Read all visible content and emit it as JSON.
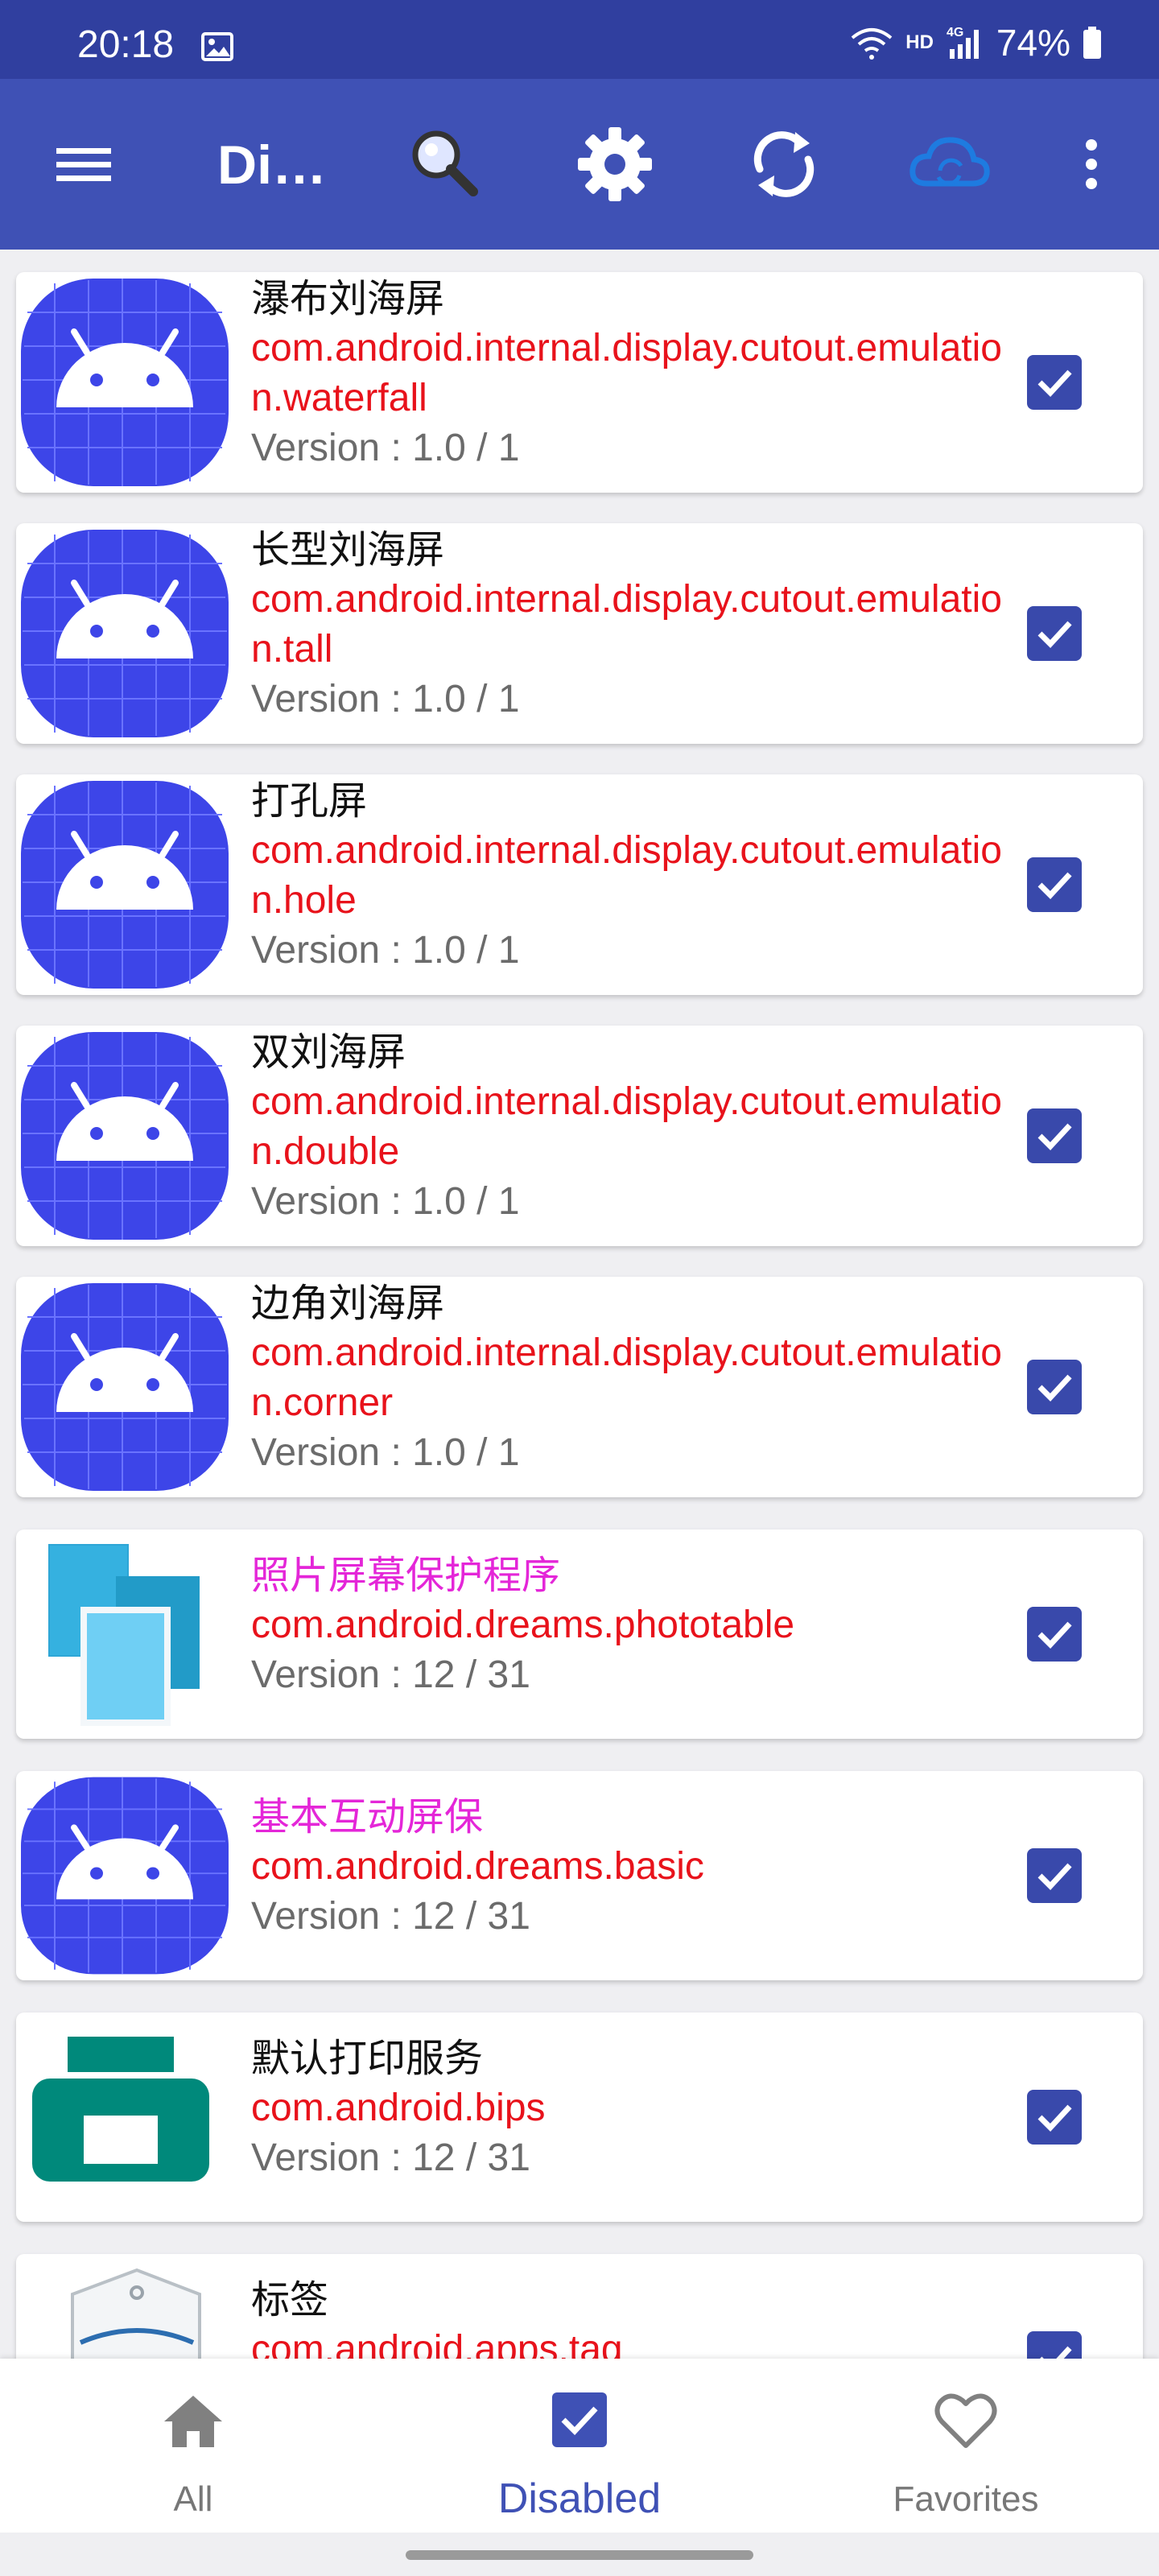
{
  "status_bar": {
    "time": "20:18",
    "network": "HD",
    "network_gen": "4G",
    "battery": "74%"
  },
  "app_bar": {
    "title": "Disabled"
  },
  "apps": [
    {
      "label": "瀑布刘海屏",
      "package": "com.android.internal.display.cutout.emulation.waterfall",
      "version": "Version : 1.0 / 1",
      "icon": "android-icon",
      "label_color": "black",
      "checked": true
    },
    {
      "label": "长型刘海屏",
      "package": "com.android.internal.display.cutout.emulation.tall",
      "version": "Version : 1.0 / 1",
      "icon": "android-icon",
      "label_color": "black",
      "checked": true
    },
    {
      "label": "打孔屏",
      "package": "com.android.internal.display.cutout.emulation.hole",
      "version": "Version : 1.0 / 1",
      "icon": "android-icon",
      "label_color": "black",
      "checked": true
    },
    {
      "label": "双刘海屏",
      "package": "com.android.internal.display.cutout.emulation.double",
      "version": "Version : 1.0 / 1",
      "icon": "android-icon",
      "label_color": "black",
      "checked": true
    },
    {
      "label": "边角刘海屏",
      "package": "com.android.internal.display.cutout.emulation.corner",
      "version": "Version : 1.0 / 1",
      "icon": "android-icon",
      "label_color": "black",
      "checked": true
    },
    {
      "label": "照片屏幕保护程序",
      "package": "com.android.dreams.phototable",
      "version": "Version : 12 / 31",
      "icon": "photo-table-icon",
      "label_color": "magenta",
      "checked": true
    },
    {
      "label": "基本互动屏保",
      "package": "com.android.dreams.basic",
      "version": "Version : 12 / 31",
      "icon": "android-icon",
      "label_color": "magenta",
      "checked": true
    },
    {
      "label": "默认打印服务",
      "package": "com.android.bips",
      "version": "Version : 12 / 31",
      "icon": "printer-icon",
      "label_color": "black",
      "checked": true
    },
    {
      "label": "标签",
      "package": "com.android.apps.tag",
      "version": "",
      "icon": "tag-icon",
      "label_color": "black",
      "checked": true
    }
  ],
  "bottom_nav": [
    {
      "label": "All",
      "icon": "home-icon",
      "active": false
    },
    {
      "label": "Disabled",
      "icon": "checkbox-icon",
      "active": true
    },
    {
      "label": "Favorites",
      "icon": "heart-icon",
      "active": false
    }
  ],
  "colors": {
    "primary": "#3f51b5",
    "status_bar": "#303f9f",
    "package_red": "#e8121b",
    "magenta_label": "#e426d8",
    "checkbox": "#3949ab"
  }
}
